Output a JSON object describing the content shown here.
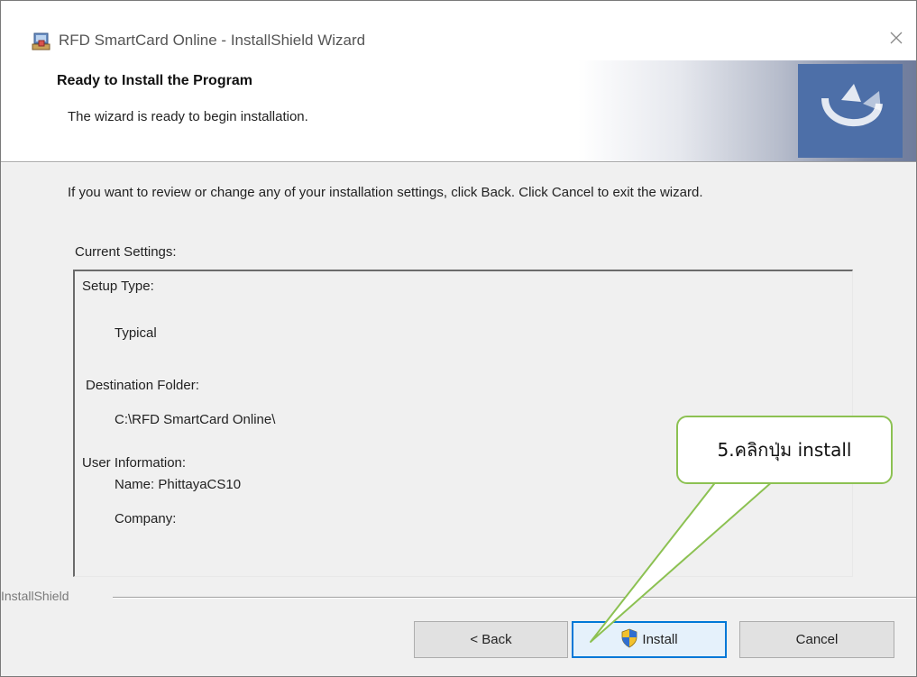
{
  "window": {
    "title": "RFD SmartCard Online - InstallShield Wizard"
  },
  "header": {
    "heading": "Ready to Install the Program",
    "subheading": "The wizard is ready to begin installation."
  },
  "body": {
    "instruction": "If you want to review or change any of your installation settings, click Back. Click Cancel to exit the wizard.",
    "current_settings_label": "Current Settings:",
    "settings": {
      "setup_type_label": "Setup Type:",
      "setup_type_value": "Typical",
      "destination_label": "Destination Folder:",
      "destination_value": "C:\\RFD SmartCard Online\\",
      "user_info_label": "User Information:",
      "name_value": "Name: PhittayaCS10",
      "company_value": "Company:"
    }
  },
  "callout": {
    "text": "5.คลิกปุ่ม install"
  },
  "footer": {
    "brand": "InstallShield",
    "back_label": "< Back",
    "install_label": "Install",
    "cancel_label": "Cancel"
  },
  "colors": {
    "accent": "#0078d7",
    "callout_border": "#8cc152",
    "banner_logo": "#4d6fa8"
  },
  "icons": {
    "app": "installer-computer-icon",
    "close": "close-icon",
    "banner": "installshield-logo-icon",
    "install": "uac-shield-icon"
  }
}
